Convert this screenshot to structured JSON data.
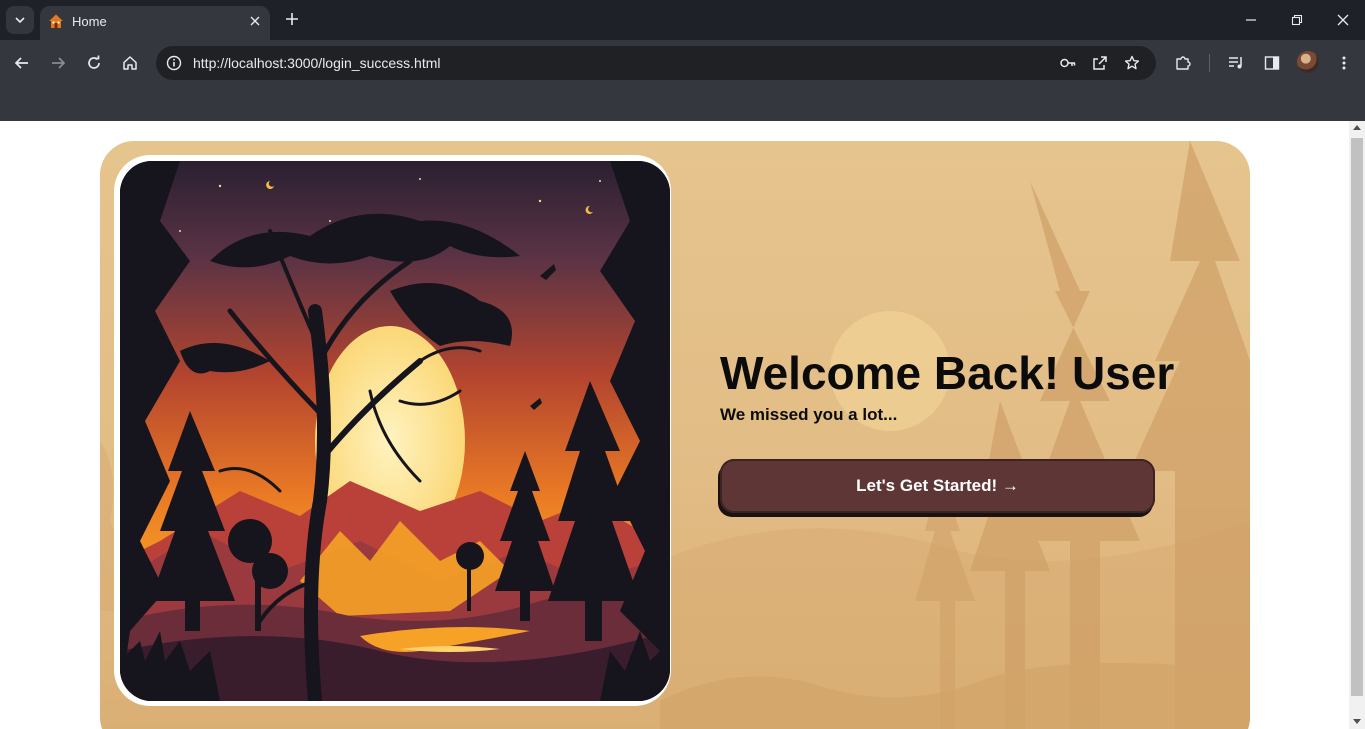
{
  "browser": {
    "tab": {
      "title": "Home",
      "favicon": "house-icon"
    },
    "address_bar": {
      "url": "http://localhost:3000/login_success.html"
    },
    "icons": {
      "tab_search": "chevron-down-icon",
      "close_tab": "close-icon",
      "new_tab": "plus-icon",
      "minimize": "minimize-icon",
      "restore": "restore-icon",
      "close_window": "close-icon",
      "back": "arrow-left-icon",
      "forward": "arrow-right-icon",
      "reload": "reload-icon",
      "home": "home-icon",
      "site_info": "info-icon",
      "passwords": "key-icon",
      "open_in": "external-link-icon",
      "bookmark": "star-icon",
      "extensions": "puzzle-icon",
      "media": "media-queue-icon",
      "side_panel": "side-panel-icon",
      "profile": "avatar",
      "menu": "kebab-menu-icon"
    }
  },
  "page": {
    "heading": "Welcome Back! User",
    "subtitle": "We missed you a lot...",
    "cta_label": "Let's Get Started! →"
  },
  "colors": {
    "card_background": "#e2bc85",
    "button_background": "#5e3636",
    "button_text": "#ffffff",
    "heading_text": "#0b0b0b"
  }
}
